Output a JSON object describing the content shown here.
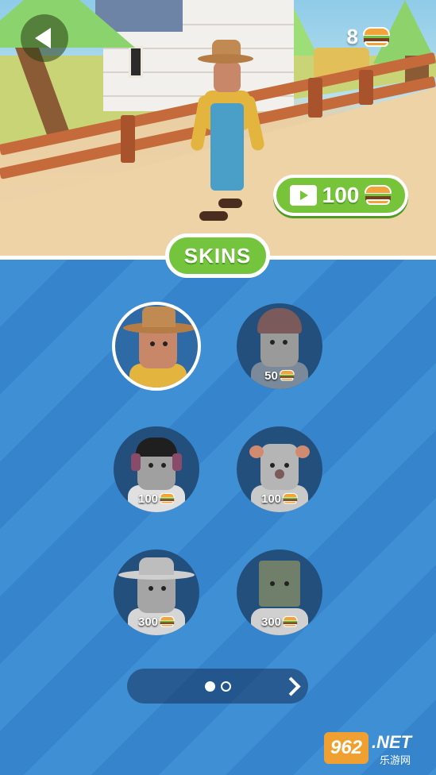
{
  "header": {
    "back_icon": "back-arrow-icon",
    "currency_amount": "8",
    "currency_icon": "burger-icon"
  },
  "reward_button": {
    "icon": "video-ad-icon",
    "amount": "100",
    "currency_icon": "burger-icon"
  },
  "tab": {
    "label": "SKINS"
  },
  "skins": [
    {
      "name": "farmer",
      "selected": true,
      "price": ""
    },
    {
      "name": "beanie-girl",
      "selected": false,
      "price": "50"
    },
    {
      "name": "headphones-girl",
      "selected": false,
      "price": "100"
    },
    {
      "name": "clown",
      "selected": false,
      "price": "100"
    },
    {
      "name": "sunhat-lady",
      "selected": false,
      "price": "300"
    },
    {
      "name": "zombie",
      "selected": false,
      "price": "300"
    }
  ],
  "pager": {
    "pages": 2,
    "current": 1
  },
  "watermark": {
    "logo": "962",
    "suffix": ".NET",
    "chinese": "乐游网"
  },
  "colors": {
    "green_accent": "#74c53d",
    "panel_blue": "#3f8fd4",
    "skin_bg": "#234f7d"
  }
}
